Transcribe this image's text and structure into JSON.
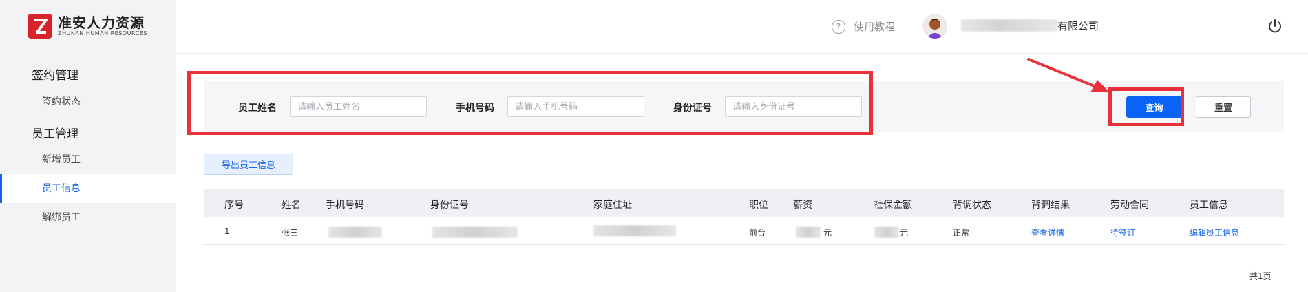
{
  "brand": {
    "name_cn": "准安人力资源",
    "name_en": "ZHUNAN HUMAN RESOURCES",
    "color": "#d8232a"
  },
  "sidebar": {
    "groups": [
      {
        "title": "签约管理",
        "items": [
          {
            "label": "签约状态",
            "active": false
          }
        ]
      },
      {
        "title": "员工管理",
        "items": [
          {
            "label": "新增员工",
            "active": false
          },
          {
            "label": "员工信息",
            "active": true
          },
          {
            "label": "解绑员工",
            "active": false
          }
        ]
      }
    ]
  },
  "header": {
    "help_label": "使用教程",
    "company_suffix": "有限公司",
    "icons": [
      "help-icon",
      "avatar",
      "power-icon"
    ]
  },
  "filters": {
    "name_label": "员工姓名",
    "name_placeholder": "请输入员工姓名",
    "name_value": "",
    "phone_label": "手机号码",
    "phone_placeholder": "请输入手机号码",
    "phone_value": "",
    "id_label": "身份证号",
    "id_placeholder": "请输入身份证号",
    "id_value": "",
    "query_label": "查询",
    "reset_label": "重置"
  },
  "export_label": "导出员工信息",
  "table": {
    "columns": [
      "序号",
      "姓名",
      "手机号码",
      "身份证号",
      "家庭住址",
      "职位",
      "薪资",
      "社保金额",
      "背调状态",
      "背调结果",
      "劳动合同",
      "员工信息"
    ],
    "rows": [
      {
        "index": "1",
        "name": "张三",
        "position": "前台",
        "salary_suffix": "元",
        "social_suffix": "元",
        "bg_status": "正常",
        "bg_result": "查看详情",
        "contract": "待签订",
        "edit": "编辑员工信息"
      }
    ]
  },
  "pager": {
    "total_label": "共1页"
  },
  "colors": {
    "accent": "#1464e6",
    "primary_button": "#0b63f6",
    "highlight": "#e8313a"
  }
}
